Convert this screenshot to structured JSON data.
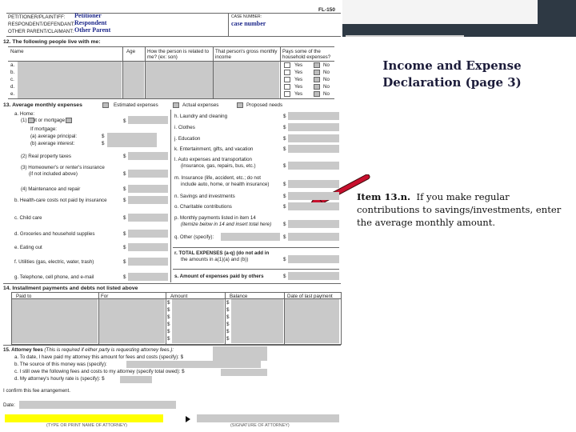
{
  "slide": {
    "title": "Income and Expense Declaration (page 3)",
    "note_bold": "Item 13.n.",
    "note_text": "If you make regular contributions to savings/investments, enter the average monthly amount."
  },
  "header": {
    "form_number": "FL-150",
    "party_labels": [
      "PETITIONER/PLAINTIFF:",
      "RESPONDENT/DEFENDANT:",
      "OTHER PARENT/CLAIMANT:"
    ],
    "party_values": [
      "Petitioner",
      "Respondent",
      "Other Parent"
    ],
    "case_number_label": "CASE NUMBER:",
    "case_number_value": "case number"
  },
  "section12": {
    "title": "12.  The following people live with me:",
    "col_name": "Name",
    "col_age": "Age",
    "col_relation": "How the person is related to me? (ex: son)",
    "col_income": "That person's gross monthly income",
    "col_pays": "Pays some of the household expenses?",
    "rows": [
      "a.",
      "b.",
      "c.",
      "d.",
      "e."
    ],
    "yes": "Yes",
    "no": "No"
  },
  "section13": {
    "title": "13.  Average monthly expenses",
    "estimated": "Estimated expenses",
    "actual": "Actual expenses",
    "proposed": "Proposed needs",
    "left": [
      "a.  Home:",
      "(1)      rent or       mortgage",
      "If mortgage:",
      "(a)  average principal:",
      "(b)  average interest:",
      "(2)  Real property taxes",
      "(3)  Homeowner's or renter's insurance",
      "(if not included above)",
      "(4)  Maintenance and repair",
      "b.  Health-care costs not paid by insurance",
      "c.  Child care",
      "d.  Groceries and household supplies",
      "e.  Eating out",
      "f.  Utilities (gas, electric, water, trash)",
      "g.  Telephone, cell phone, and e-mail"
    ],
    "right": [
      "h.  Laundry and cleaning",
      "i.  Clothes",
      "j.  Education",
      "k.  Entertainment, gifts, and vacation",
      "l.  Auto expenses and transportation",
      "(insurance, gas, repairs, bus, etc.)",
      "m.  Insurance (life, accident, etc.; do not",
      "include auto, home, or health insurance)",
      "n.  Savings and investments",
      "o.  Charitable contributions",
      "p.  Monthly payments listed in item 14",
      "(itemize below in 14 and insert total here)",
      "q.  Other (specify):",
      "r.  TOTAL EXPENSES (a-q) (do not add in",
      "the amounts in a(1)(a) and (b))",
      "s.  Amount of expenses paid by others"
    ],
    "dollar": "$"
  },
  "section14": {
    "title": "14.  Installment payments and debts not listed above",
    "cols": [
      "Paid to",
      "For",
      "Amount",
      "Balance",
      "Date of last payment"
    ]
  },
  "section15": {
    "title": "15.  Attorney fees",
    "subtitle": "(This is required if either party is requesting attorney fees.):",
    "lines": [
      "a.  To date, I have paid my attorney this amount for fees and costs (specify):  $",
      "b.  The source of this money was (specify):",
      "c.  I still owe the following fees and costs to my attorney (specify total owed):  $",
      "d.  My attorney's hourly rate is (specify):  $"
    ],
    "confirm": "I confirm this fee arrangement.",
    "date": "Date:",
    "sig_left": "(TYPE OR PRINT NAME OF ATTORNEY)",
    "sig_right": "(SIGNATURE OF ATTORNEY)"
  },
  "colors": {
    "arrow": "#c8102e",
    "field_grey": "#c9c9c9",
    "highlight": "#ffff00",
    "topbar": "#2f3a44"
  }
}
